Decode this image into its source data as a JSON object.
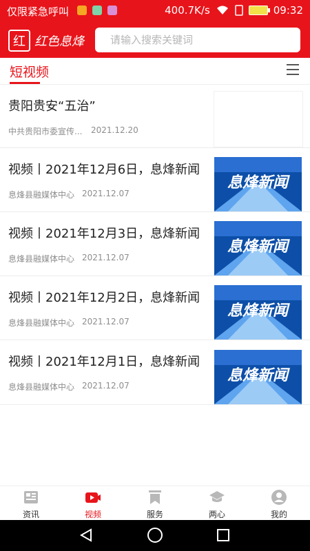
{
  "status_bar": {
    "carrier_text": "仅限紧急呼叫",
    "net_speed": "400.7K/s",
    "time": "09:32",
    "app_icon_colors": [
      "#f5a623",
      "#7ed3a8",
      "#d98fd6"
    ]
  },
  "header": {
    "logo_text": "红色息烽",
    "search_placeholder": "请输入搜索关键词"
  },
  "tab": {
    "active_label": "短视频"
  },
  "news": [
    {
      "title": "贵阳贵安“五治”",
      "source": "中共贵阳市委宣传...",
      "date": "2021.12.20",
      "has_image": false
    },
    {
      "title": "视频丨2021年12月6日，息烽新闻",
      "source": "息烽县融媒体中心",
      "date": "2021.12.07",
      "has_image": true,
      "thumb_text": "息烽新闻"
    },
    {
      "title": "视频丨2021年12月3日，息烽新闻",
      "source": "息烽县融媒体中心",
      "date": "2021.12.07",
      "has_image": true,
      "thumb_text": "息烽新闻"
    },
    {
      "title": "视频丨2021年12月2日，息烽新闻",
      "source": "息烽县融媒体中心",
      "date": "2021.12.07",
      "has_image": true,
      "thumb_text": "息烽新闻"
    },
    {
      "title": "视频丨2021年12月1日，息烽新闻",
      "source": "息烽县融媒体中心",
      "date": "2021.12.07",
      "has_image": true,
      "thumb_text": "息烽新闻"
    }
  ],
  "bottom_nav": [
    {
      "label": "资讯",
      "icon": "newspaper-icon",
      "active": false
    },
    {
      "label": "视频",
      "icon": "video-play-icon",
      "active": true
    },
    {
      "label": "服务",
      "icon": "bookmark-icon",
      "active": false
    },
    {
      "label": "两心",
      "icon": "graduation-cap-icon",
      "active": false
    },
    {
      "label": "我的",
      "icon": "user-avatar-icon",
      "active": false
    }
  ],
  "colors": {
    "brand_red": "#e8141b",
    "thumb_blue": "#0d4fa8"
  }
}
